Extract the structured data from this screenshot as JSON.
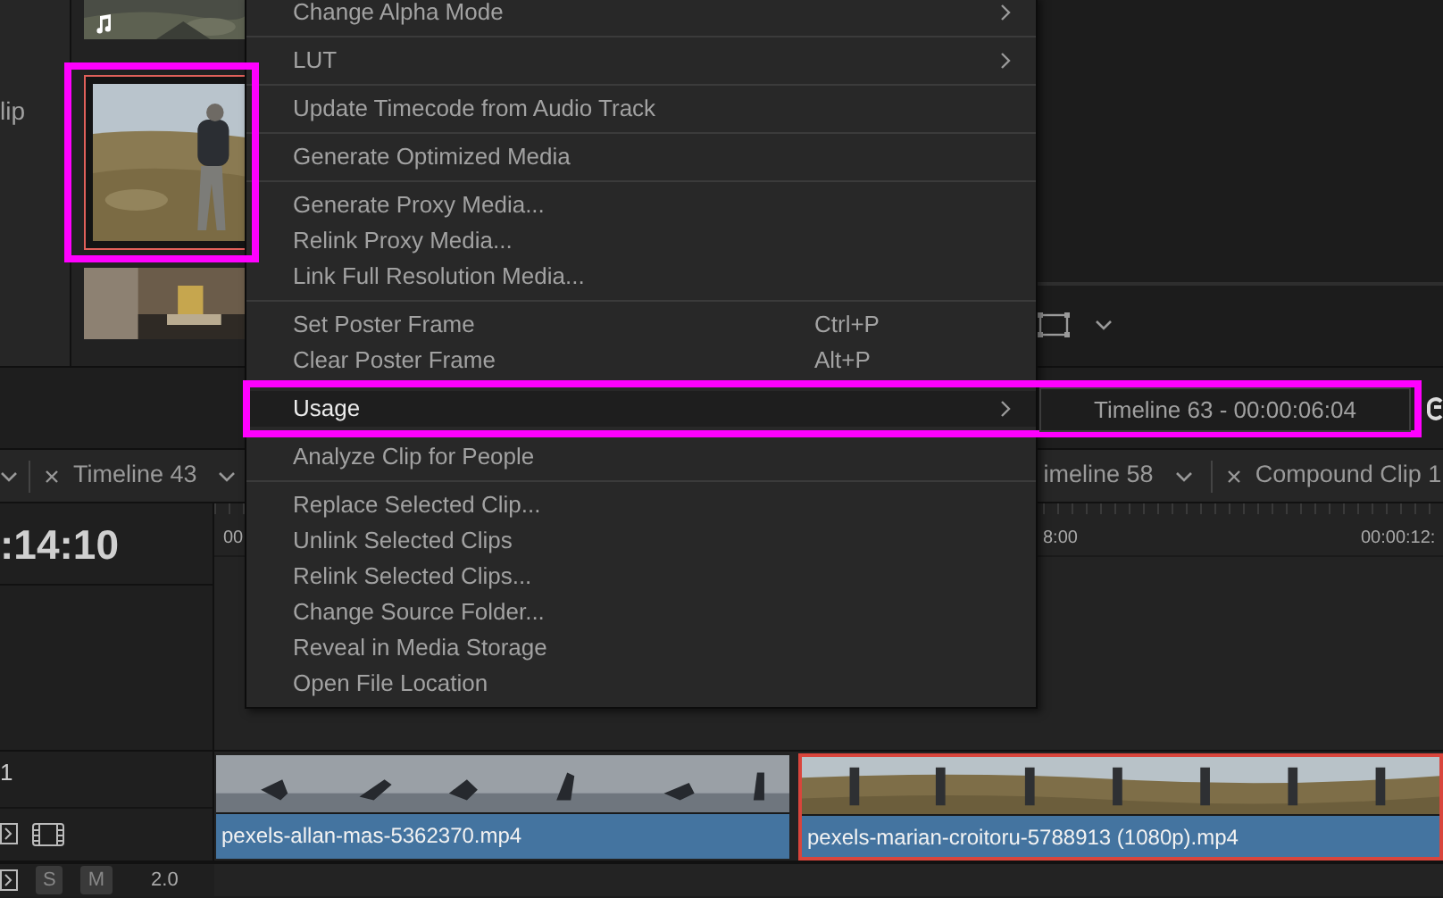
{
  "media_pool": {
    "side_label": "lip",
    "thumbnails": [
      {
        "kind": "audio",
        "highlighted": false
      },
      {
        "kind": "video",
        "highlighted": true
      },
      {
        "kind": "video",
        "highlighted": false
      }
    ]
  },
  "context_menu": {
    "groups": [
      [
        {
          "label": "Change Alpha Mode",
          "has_submenu": true,
          "selected": false,
          "highlighted": false
        }
      ],
      [
        {
          "label": "LUT",
          "has_submenu": true,
          "selected": false,
          "highlighted": false
        }
      ],
      [
        {
          "label": "Update Timecode from Audio Track",
          "has_submenu": false,
          "selected": false,
          "highlighted": false
        }
      ],
      [
        {
          "label": "Generate Optimized Media",
          "has_submenu": false,
          "selected": false,
          "highlighted": false
        }
      ],
      [
        {
          "label": "Generate Proxy Media...",
          "has_submenu": false,
          "selected": false,
          "highlighted": false
        },
        {
          "label": "Relink Proxy Media...",
          "has_submenu": false,
          "selected": false,
          "highlighted": false
        },
        {
          "label": "Link Full Resolution Media...",
          "has_submenu": false,
          "selected": false,
          "highlighted": false
        }
      ],
      [
        {
          "label": "Set Poster Frame",
          "shortcut": "Ctrl+P",
          "has_submenu": false,
          "selected": false,
          "highlighted": false
        },
        {
          "label": "Clear Poster Frame",
          "shortcut": "Alt+P",
          "has_submenu": false,
          "selected": false,
          "highlighted": false
        }
      ],
      [
        {
          "label": "Usage",
          "has_submenu": true,
          "selected": true,
          "highlighted": true
        }
      ],
      [
        {
          "label": "Analyze Clip for People",
          "has_submenu": false,
          "selected": false,
          "highlighted": false
        }
      ],
      [
        {
          "label": "Replace Selected Clip...",
          "has_submenu": false,
          "selected": false,
          "highlighted": false
        },
        {
          "label": "Unlink Selected Clips",
          "has_submenu": false,
          "selected": false,
          "highlighted": false
        },
        {
          "label": "Relink Selected Clips...",
          "has_submenu": false,
          "selected": false,
          "highlighted": false
        },
        {
          "label": "Change Source Folder...",
          "has_submenu": false,
          "selected": false,
          "highlighted": false
        },
        {
          "label": "Reveal in Media Storage",
          "has_submenu": false,
          "selected": false,
          "highlighted": false
        },
        {
          "label": "Open File Location",
          "has_submenu": false,
          "selected": false,
          "highlighted": false
        }
      ]
    ]
  },
  "usage_submenu": {
    "text": "Timeline 63 - 00:00:06:04"
  },
  "timeline_tabs": [
    {
      "label": "Timeline 43"
    },
    {
      "label": "imeline 58"
    },
    {
      "label": "Compound Clip 1"
    }
  ],
  "timecode": ":14:10",
  "ruler_labels": [
    "00",
    "8:00",
    "00:00:12:"
  ],
  "video_track": {
    "label": "1",
    "clips": [
      {
        "name": "pexels-allan-mas-5362370.mp4",
        "selected": false
      },
      {
        "name": "pexels-marian-croitoru-5788913 (1080p).mp4",
        "selected": true
      }
    ]
  },
  "audio_track": {
    "solo": "S",
    "mute": "M",
    "level_reading": "2.0"
  }
}
